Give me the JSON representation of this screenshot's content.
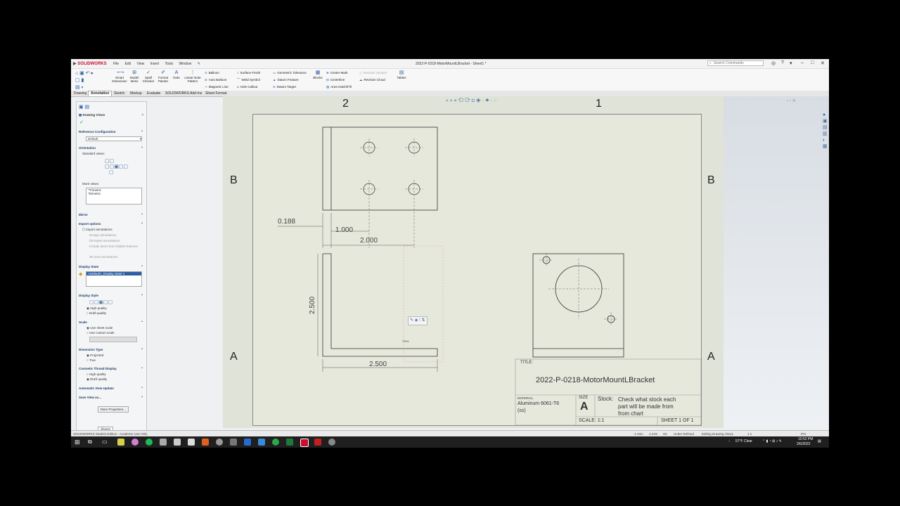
{
  "app": {
    "logo": "SOLIDWORKS",
    "menu": [
      "File",
      "Edit",
      "View",
      "Insert",
      "Tools",
      "Window"
    ],
    "title": "2022-P-0218-MotorMountLBracket - Sheet1 *",
    "search_placeholder": "Search Commands"
  },
  "ribbon": {
    "smart_dimension": "Smart Dimension",
    "model_items": "Model Items",
    "spell_checker": "Spell Checker",
    "format_painter": "Format Painter",
    "note": "Note",
    "linear_note_pattern": "Linear Note Pattern",
    "balloon": "Balloon",
    "auto_balloon": "Auto Balloon",
    "magnetic_line": "Magnetic Line",
    "surface_finish": "Surface Finish",
    "weld_symbol": "Weld Symbol",
    "hole_callout": "Hole Callout",
    "geometric_tolerance": "Geometric Tolerance",
    "datum_feature": "Datum Feature",
    "datum_target": "Datum Target",
    "blocks": "Blocks",
    "center_mark": "Center Mark",
    "centerline": "Centerline",
    "area_hatch": "Area Hatch/Fill",
    "revision_symbol": "Revision Symbol",
    "revision_cloud": "Revision Cloud",
    "tables": "Tables"
  },
  "tabs": [
    "Drawing",
    "Annotation",
    "Sketch",
    "Markup",
    "Evaluate",
    "SOLIDWORKS Add-Ins",
    "Sheet Format"
  ],
  "active_tab": "Annotation",
  "property_manager": {
    "title": "Drawing View1",
    "reference_configuration": "Reference Configuration",
    "configuration_value": "Default",
    "orientation": "Orientation",
    "standard_views": "Standard views:",
    "more_views": "More views:",
    "more_views_items": [
      "*Trimetric",
      "*Dimetric"
    ],
    "mirror": "Mirror",
    "import_options": "Import options",
    "import_annotations": "Import annotations",
    "design_annotations": "Design annotations",
    "dimxpert_annotations": "DimXpert annotations",
    "include_items_hidden": "Include items from hidden features",
    "view_3d_annotations": "3D view annotations",
    "display_state": "Display State",
    "display_state_value": "<Default>_Display State 1",
    "display_style": "Display Style",
    "high_quality": "High quality",
    "draft_quality": "Draft quality",
    "scale": "Scale",
    "use_sheet_scale": "Use sheet scale",
    "use_custom_scale": "Use custom scale",
    "dimension_type": "Dimension Type",
    "projected": "Projected",
    "true": "True",
    "cosmetic_thread": "Cosmetic Thread Display",
    "ct_high": "High quality",
    "ct_draft": "Draft quality",
    "auto_view_update": "Automatic View Update",
    "save_view_as": "Save View as...",
    "more_properties": "More Properties...",
    "sheet_tab": "Sheet1"
  },
  "drawing": {
    "zone_cols": [
      "2",
      "1"
    ],
    "zone_rows": [
      "B",
      "A"
    ],
    "dims": {
      "d1": "0.188",
      "d2": "1.000",
      "d3": "2.000",
      "d4": "2.500",
      "d5": "2.500"
    },
    "view_label": "View",
    "title_label": "TITLE:",
    "title_value": "2022-P-0218-MotorMountLBracket",
    "material_label": "MATERIAL",
    "material_value": "Aluminum 6061-T6",
    "material_sub": "(ss)",
    "size_label": "SIZE",
    "size_value": "A",
    "stock_label": "Stock:",
    "stock_lines": [
      "Check what stock each",
      "part will be made from",
      "from chart"
    ],
    "scale_value": "SCALE: 1:1",
    "sheet_value": "SHEET 1 OF 1"
  },
  "status": {
    "left": "SOLIDWORKS Student Edition - Academic Use Only",
    "coord1": "-1.91in",
    "coord2": "4.23in",
    "coord3": "0in",
    "state": "Under Defined",
    "editing": "Editing Drawing View1",
    "scale": "1:1",
    "units": "IPS"
  },
  "taskbar": {
    "weather": "57°F Clear",
    "time": "10:52 PM",
    "date": "2/6/2022"
  },
  "colors": {
    "accent": "#2b5fa5",
    "sheet": "#e6e8dc",
    "brand": "#c8102e"
  }
}
